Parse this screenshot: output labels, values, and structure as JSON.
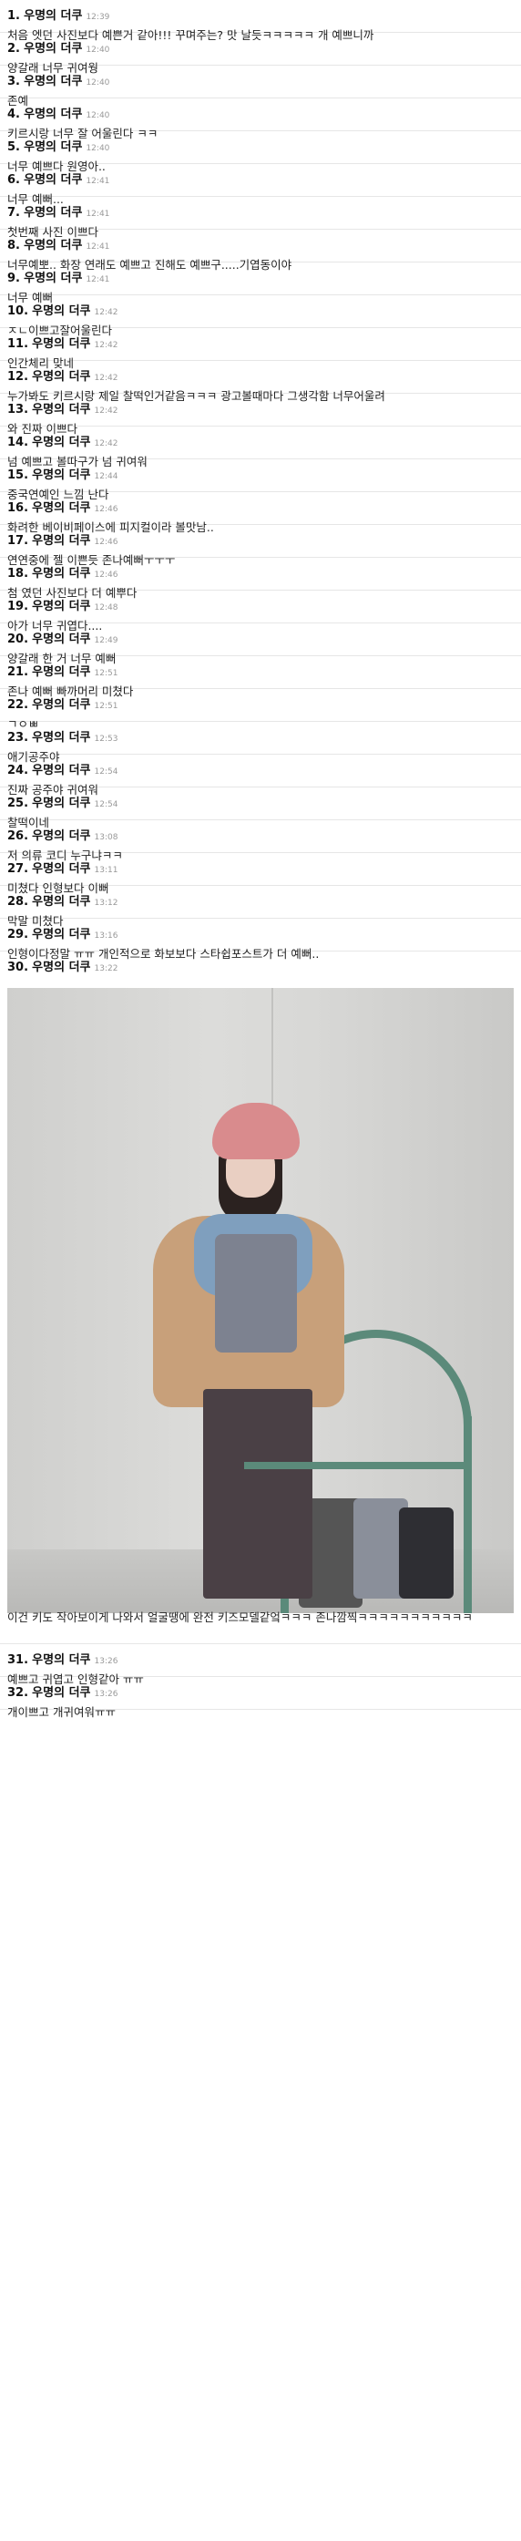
{
  "comments": [
    {
      "no": "1.",
      "author": "우명의 더쿠",
      "time": "12:39",
      "text": "처음 엣던 사진보다 예쁜거 같아!!! 꾸며주는? 맛 날듯ㅋㅋㅋㅋㅋ 개 예쁘니까"
    },
    {
      "no": "2.",
      "author": "우명의 더쿠",
      "time": "12:40",
      "text": "양갈래 너무 귀여웡"
    },
    {
      "no": "3.",
      "author": "우명의 더쿠",
      "time": "12:40",
      "text": "존예"
    },
    {
      "no": "4.",
      "author": "우명의 더쿠",
      "time": "12:40",
      "text": "키르시랑 너무 잘 어울린다 ㅋㅋ"
    },
    {
      "no": "5.",
      "author": "우명의 더쿠",
      "time": "12:40",
      "text": "너무 예쁘다 원영아.."
    },
    {
      "no": "6.",
      "author": "우명의 더쿠",
      "time": "12:41",
      "text": "너무 예뻐..."
    },
    {
      "no": "7.",
      "author": "우명의 더쿠",
      "time": "12:41",
      "text": "첫번째 사진 이쁘다"
    },
    {
      "no": "8.",
      "author": "우명의 더쿠",
      "time": "12:41",
      "text": "너무예뽀.. 화장 연래도 예쁘고 진해도 예쁘구.....기엽동이야"
    },
    {
      "no": "9.",
      "author": "우명의 더쿠",
      "time": "12:41",
      "text": "너무 예뻐"
    },
    {
      "no": "10.",
      "author": "우명의 더쿠",
      "time": "12:42",
      "text": "ㅈㄴ이쁘고잘어울린다"
    },
    {
      "no": "11.",
      "author": "우명의 더쿠",
      "time": "12:42",
      "text": "인간체리 맞네"
    },
    {
      "no": "12.",
      "author": "우명의 더쿠",
      "time": "12:42",
      "text": "누가봐도 키르시랑 제일 찰떡인거같음ㅋㅋㅋ 광고볼때마다 그생각함 너무어울려"
    },
    {
      "no": "13.",
      "author": "우명의 더쿠",
      "time": "12:42",
      "text": "와 진짜 이쁘다"
    },
    {
      "no": "14.",
      "author": "우명의 더쿠",
      "time": "12:42",
      "text": "넘 예쁘고 볼따구가 넘 귀여워"
    },
    {
      "no": "15.",
      "author": "우명의 더쿠",
      "time": "12:44",
      "text": "중국연예인 느낌 난다"
    },
    {
      "no": "16.",
      "author": "우명의 더쿠",
      "time": "12:46",
      "text": "화려한 베이비페이스에 피지컬이라 볼맛남.."
    },
    {
      "no": "17.",
      "author": "우명의 더쿠",
      "time": "12:46",
      "text": "연연중에 젤 이쁜듯 존나예뻐ㅜㅜㅜ"
    },
    {
      "no": "18.",
      "author": "우명의 더쿠",
      "time": "12:46",
      "text": "첨 였던 사진보다 더 예뿌다"
    },
    {
      "no": "19.",
      "author": "우명의 더쿠",
      "time": "12:48",
      "text": "아가 너무 귀엽다...."
    },
    {
      "no": "20.",
      "author": "우명의 더쿠",
      "time": "12:49",
      "text": "양갈래 한 거 너무 예뻐"
    },
    {
      "no": "21.",
      "author": "우명의 더쿠",
      "time": "12:51",
      "text": "존나 예뻐 빠까머리 미쳤다"
    },
    {
      "no": "22.",
      "author": "우명의 더쿠",
      "time": "12:51",
      "text": "ㄱㅇㅃ"
    },
    {
      "no": "23.",
      "author": "우명의 더쿠",
      "time": "12:53",
      "text": "애기공주야"
    },
    {
      "no": "24.",
      "author": "우명의 더쿠",
      "time": "12:54",
      "text": "진짜 공주야 귀여워"
    },
    {
      "no": "25.",
      "author": "우명의 더쿠",
      "time": "12:54",
      "text": "찰떡이네"
    },
    {
      "no": "26.",
      "author": "우명의 더쿠",
      "time": "13:08",
      "text": "저 의류 코디 누구냐ㅋㅋ"
    },
    {
      "no": "27.",
      "author": "우명의 더쿠",
      "time": "13:11",
      "text": "미쳤다 인형보다 이뻐"
    },
    {
      "no": "28.",
      "author": "우명의 더쿠",
      "time": "13:12",
      "text": "막말 미쳤다"
    },
    {
      "no": "29.",
      "author": "우명의 더쿠",
      "time": "13:16",
      "text": "인형이다정말 ㅠㅠ 개인적으로 화보보다 스타쉽포스트가 더 예뻐.."
    },
    {
      "no": "30.",
      "author": "우명의 더쿠",
      "time": "13:22",
      "text": "이건 키도 작아보이게 나와서 얼굴땡에 완전 키즈모델같엌ㅋㅋㅋ 존나깜찍ㅋㅋㅋㅋㅋㅋㅋㅋㅋㅋㅋ",
      "photo": true
    },
    {
      "no": "31.",
      "author": "우명의 더쿠",
      "time": "13:26",
      "text": "예쁘고 귀엽고 인형같아 ㅠㅠ"
    },
    {
      "no": "32.",
      "author": "우명의 더쿠",
      "time": "13:26",
      "text": "개이쁘고 개귀여워ㅠㅠ"
    }
  ]
}
